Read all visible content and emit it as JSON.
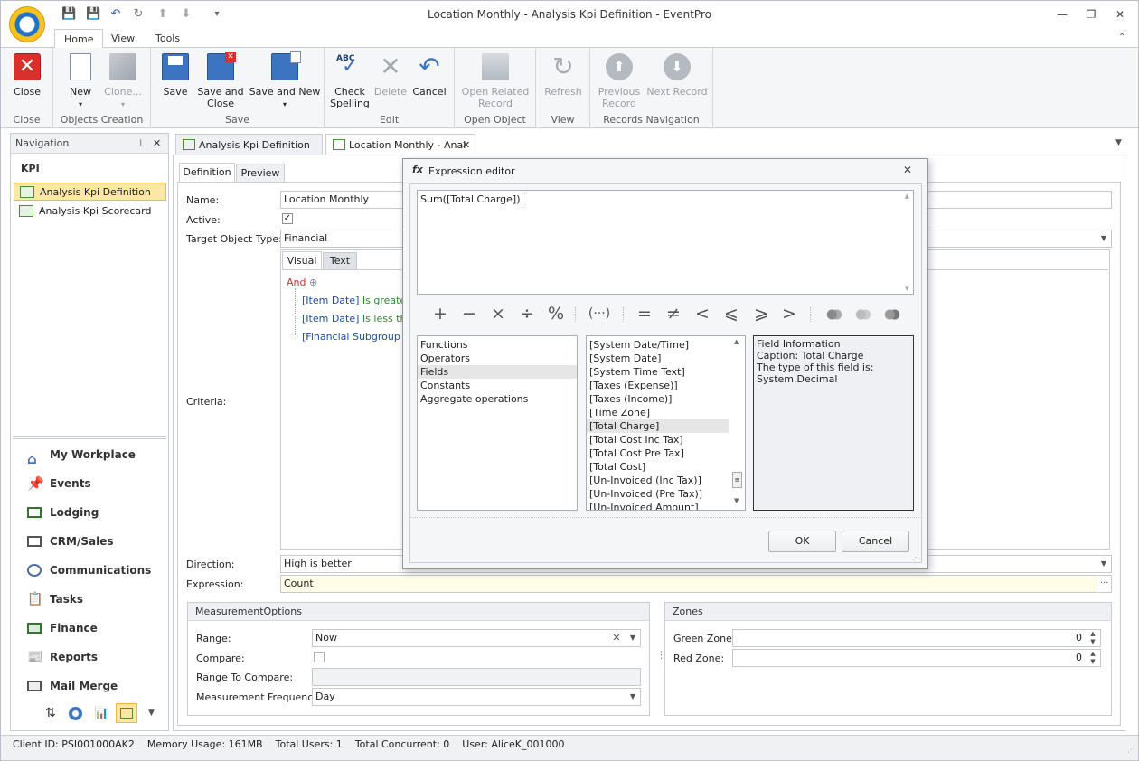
{
  "window": {
    "title": "Location Monthly - Analysis Kpi Definition - EventPro"
  },
  "ribbon_tabs": [
    "Home",
    "View",
    "Tools"
  ],
  "ribbon": {
    "close": {
      "label": "Close",
      "group": "Close"
    },
    "new": {
      "label": "New"
    },
    "clone": {
      "label": "Clone..."
    },
    "objects_group": "Objects Creation",
    "save": {
      "label": "Save"
    },
    "save_close": {
      "label1": "Save and",
      "label2": "Close"
    },
    "save_new": {
      "label": "Save and New"
    },
    "save_group": "Save",
    "check_spelling": {
      "label1": "Check",
      "label2": "Spelling",
      "abc": "ABC"
    },
    "delete": {
      "label": "Delete"
    },
    "cancel": {
      "label": "Cancel"
    },
    "edit_group": "Edit",
    "open_related": {
      "label1": "Open Related",
      "label2": "Record"
    },
    "open_group": "Open Object",
    "refresh": {
      "label": "Refresh"
    },
    "view_group": "View",
    "previous": {
      "label1": "Previous",
      "label2": "Record"
    },
    "next": {
      "label": "Next Record"
    },
    "records_group": "Records Navigation"
  },
  "navigation": {
    "header": "Navigation",
    "section": "KPI",
    "items": [
      "Analysis Kpi Definition",
      "Analysis Kpi Scorecard"
    ],
    "modules": [
      "My Workplace",
      "Events",
      "Lodging",
      "CRM/Sales",
      "Communications",
      "Tasks",
      "Finance",
      "Reports",
      "Mail Merge"
    ]
  },
  "doc_tabs": [
    "Analysis Kpi Definition",
    "Location Monthly - Anal"
  ],
  "subtabs": [
    "Definition",
    "Preview"
  ],
  "form": {
    "name_label": "Name:",
    "name_value": "Location Monthly",
    "active_label": "Active:",
    "target_label": "Target Object Type:",
    "target_value": "Financial",
    "criteria_label": "Criteria:",
    "criteria_tabs": [
      "Visual",
      "Text"
    ],
    "criteria_and": "And",
    "criteria_items": [
      {
        "field": "[Item Date]",
        "op": "Is greater"
      },
      {
        "field": "[Item Date]",
        "op": "Is less tha"
      },
      {
        "field": "[Financial Subgroup Ty",
        "op": ""
      }
    ],
    "direction_label": "Direction:",
    "direction_value": "High is better",
    "expression_label": "Expression:",
    "expression_value": "Count"
  },
  "measurement": {
    "header": "MeasurementOptions",
    "range_label": "Range:",
    "range_value": "Now",
    "compare_label": "Compare:",
    "range_compare_label": "Range To Compare:",
    "freq_label": "Measurement Frequency:",
    "freq_value": "Day"
  },
  "zones": {
    "header": "Zones",
    "green_label": "Green Zone:",
    "green_value": "0",
    "red_label": "Red Zone:",
    "red_value": "0"
  },
  "dialog": {
    "title": "Expression editor",
    "expression": "Sum([Total Charge])",
    "operators": [
      "+",
      "−",
      "×",
      "÷",
      "%",
      "(···)",
      "=",
      "≠",
      "<",
      "⩽",
      "⩾",
      ">"
    ],
    "categories": [
      "Functions",
      "Operators",
      "Fields",
      "Constants",
      "Aggregate operations"
    ],
    "selected_category": 2,
    "fields": [
      "[System Date/Time]",
      "[System Date]",
      "[System Time Text]",
      "[Taxes (Expense)]",
      "[Taxes (Income)]",
      "[Time Zone]",
      "[Total Charge]",
      "[Total Cost Inc Tax]",
      "[Total Cost Pre Tax]",
      "[Total Cost]",
      "[Un-Invoiced (Inc Tax)]",
      "[Un-Invoiced (Pre Tax)]",
      "[Un-Invoiced Amount]"
    ],
    "selected_field": 6,
    "info": [
      "Field Information",
      "Caption: Total Charge",
      "The type of this field is:",
      "System.Decimal"
    ],
    "ok": "OK",
    "cancel": "Cancel"
  },
  "status": {
    "client_id": "Client ID: PSI001000AK2",
    "memory": "Memory Usage: 161MB",
    "users": "Total Users: 1",
    "concurrent": "Total Concurrent: 0",
    "user": "User: AliceK_001000"
  },
  "colors": {
    "accent": "#1e73c8",
    "selection": "#fce7a4",
    "expression_bg": "#fefde8",
    "close_red": "#d9302c"
  }
}
